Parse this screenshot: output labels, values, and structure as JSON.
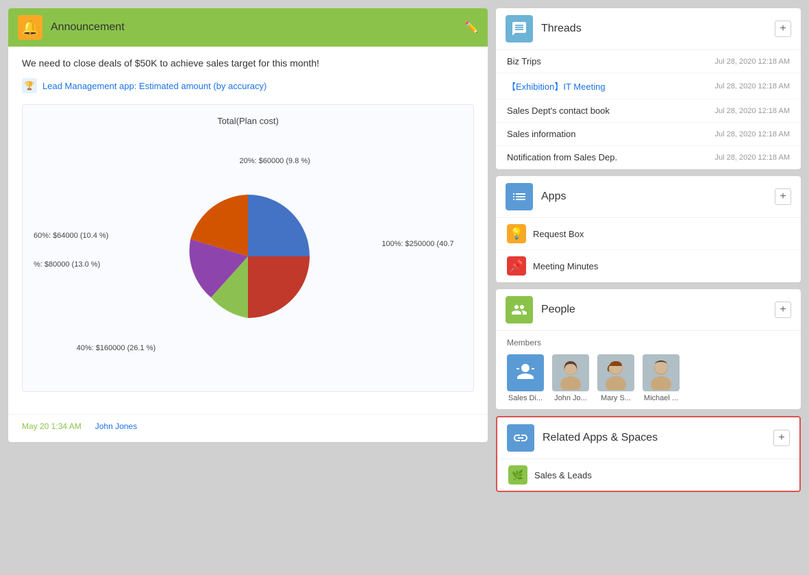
{
  "announcement": {
    "header_title": "Announcement",
    "bell_icon": "🔔",
    "message": "We need to close deals of $50K to achieve sales target for this month!",
    "app_link_text": "Lead Management app: Estimated amount (by accuracy)",
    "chart_title": "Total(Plan cost)",
    "chart_labels": {
      "label_100": "100%: $250000 (40.7",
      "label_20": "20%: $60000 (9.8 %)",
      "label_60": "60%: $64000 (10.4 %)",
      "label_pct": "%: $80000 (13.0 %)",
      "label_40": "40%: $160000 (26.1 %)"
    },
    "footer_date": "May 20 1:34 AM",
    "footer_author": "John Jones"
  },
  "threads": {
    "title": "Threads",
    "add_label": "+",
    "items": [
      {
        "name": "Biz Trips",
        "date": "Jul 28, 2020 12:18 AM",
        "highlight": false
      },
      {
        "name": "【Exhibition】IT Meeting",
        "date": "Jul 28, 2020 12:18 AM",
        "highlight": true
      },
      {
        "name": "Sales Dept's contact book",
        "date": "Jul 28, 2020 12:18 AM",
        "highlight": false
      },
      {
        "name": "Sales information",
        "date": "Jul 28, 2020 12:18 AM",
        "highlight": false
      },
      {
        "name": "Notification from Sales Dep.",
        "date": "Jul 28, 2020 12:18 AM",
        "highlight": false
      }
    ]
  },
  "apps": {
    "title": "Apps",
    "add_label": "+",
    "items": [
      {
        "name": "Request Box",
        "icon": "💡",
        "icon_bg": "#f9a825"
      },
      {
        "name": "Meeting Minutes",
        "icon": "📌",
        "icon_bg": "#e53935"
      }
    ]
  },
  "people": {
    "title": "People",
    "add_label": "+",
    "members_label": "Members",
    "members": [
      {
        "name": "Sales Di...",
        "type": "icon"
      },
      {
        "name": "John Jo...",
        "type": "photo1"
      },
      {
        "name": "Mary S...",
        "type": "photo2"
      },
      {
        "name": "Michael ...",
        "type": "photo3"
      }
    ]
  },
  "related": {
    "title": "Related Apps & Spaces",
    "add_label": "+",
    "items": [
      {
        "name": "Sales & Leads",
        "icon": "🌿"
      }
    ]
  }
}
